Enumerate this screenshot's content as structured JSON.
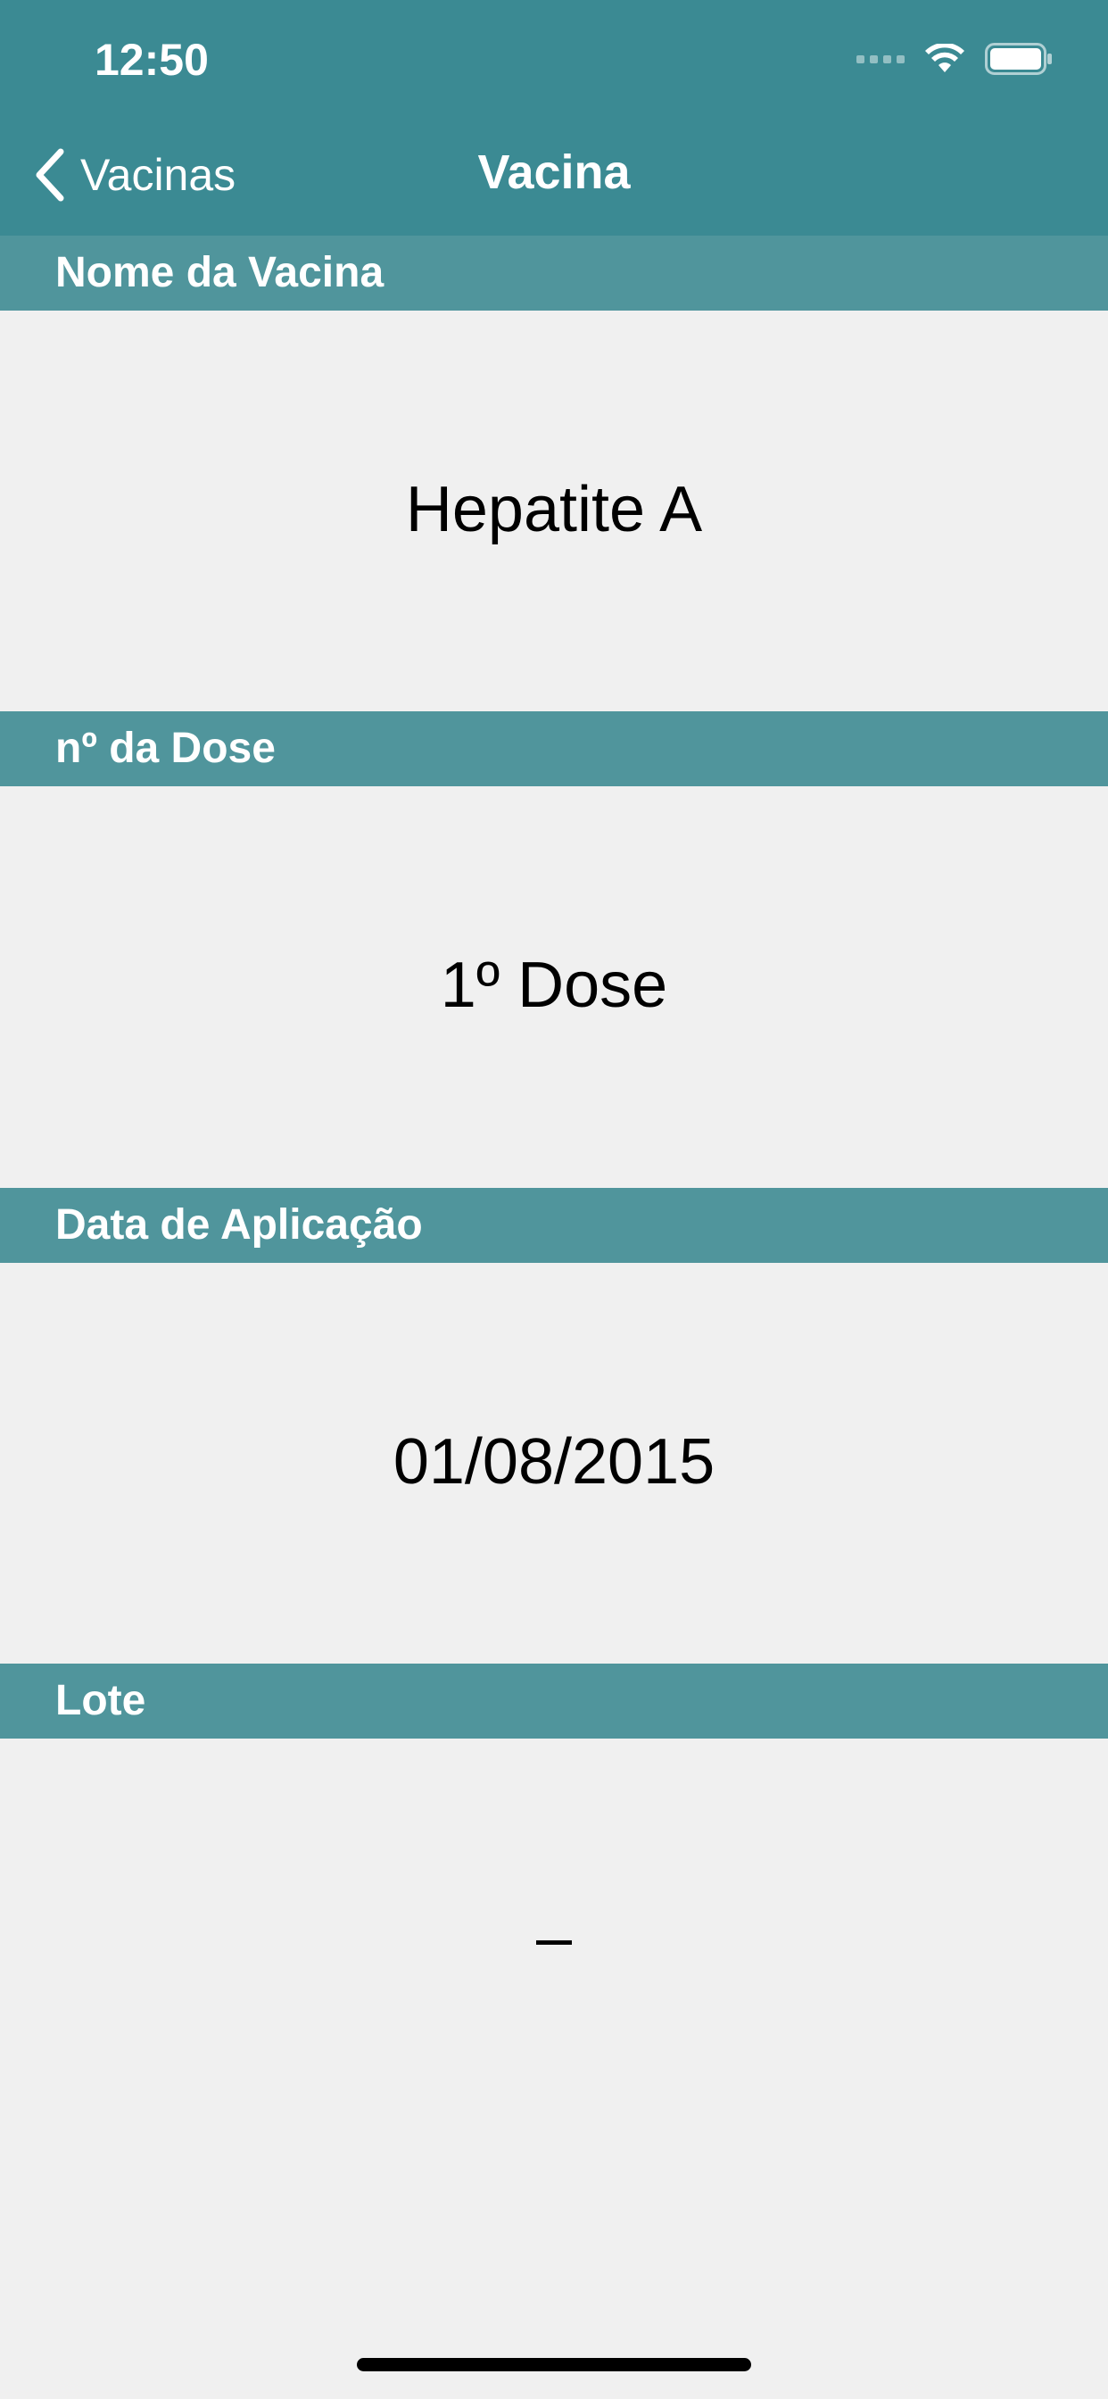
{
  "status_bar": {
    "time": "12:50"
  },
  "nav": {
    "back_label": "Vacinas",
    "title": "Vacina"
  },
  "sections": [
    {
      "header": "Nome da Vacina",
      "value": "Hepatite A"
    },
    {
      "header": "nº da Dose",
      "value": "1º Dose"
    },
    {
      "header": "Data de Aplicação",
      "value": "01/08/2015"
    },
    {
      "header": "Lote",
      "value": "–"
    }
  ],
  "colors": {
    "nav_bar": "#3b8a93",
    "section_header": "#50959c",
    "background": "#f0f0f0"
  },
  "icons": {
    "back": "chevron-left-icon",
    "wifi": "wifi-icon",
    "battery": "battery-icon",
    "signal": "cellular-signal-icon"
  }
}
